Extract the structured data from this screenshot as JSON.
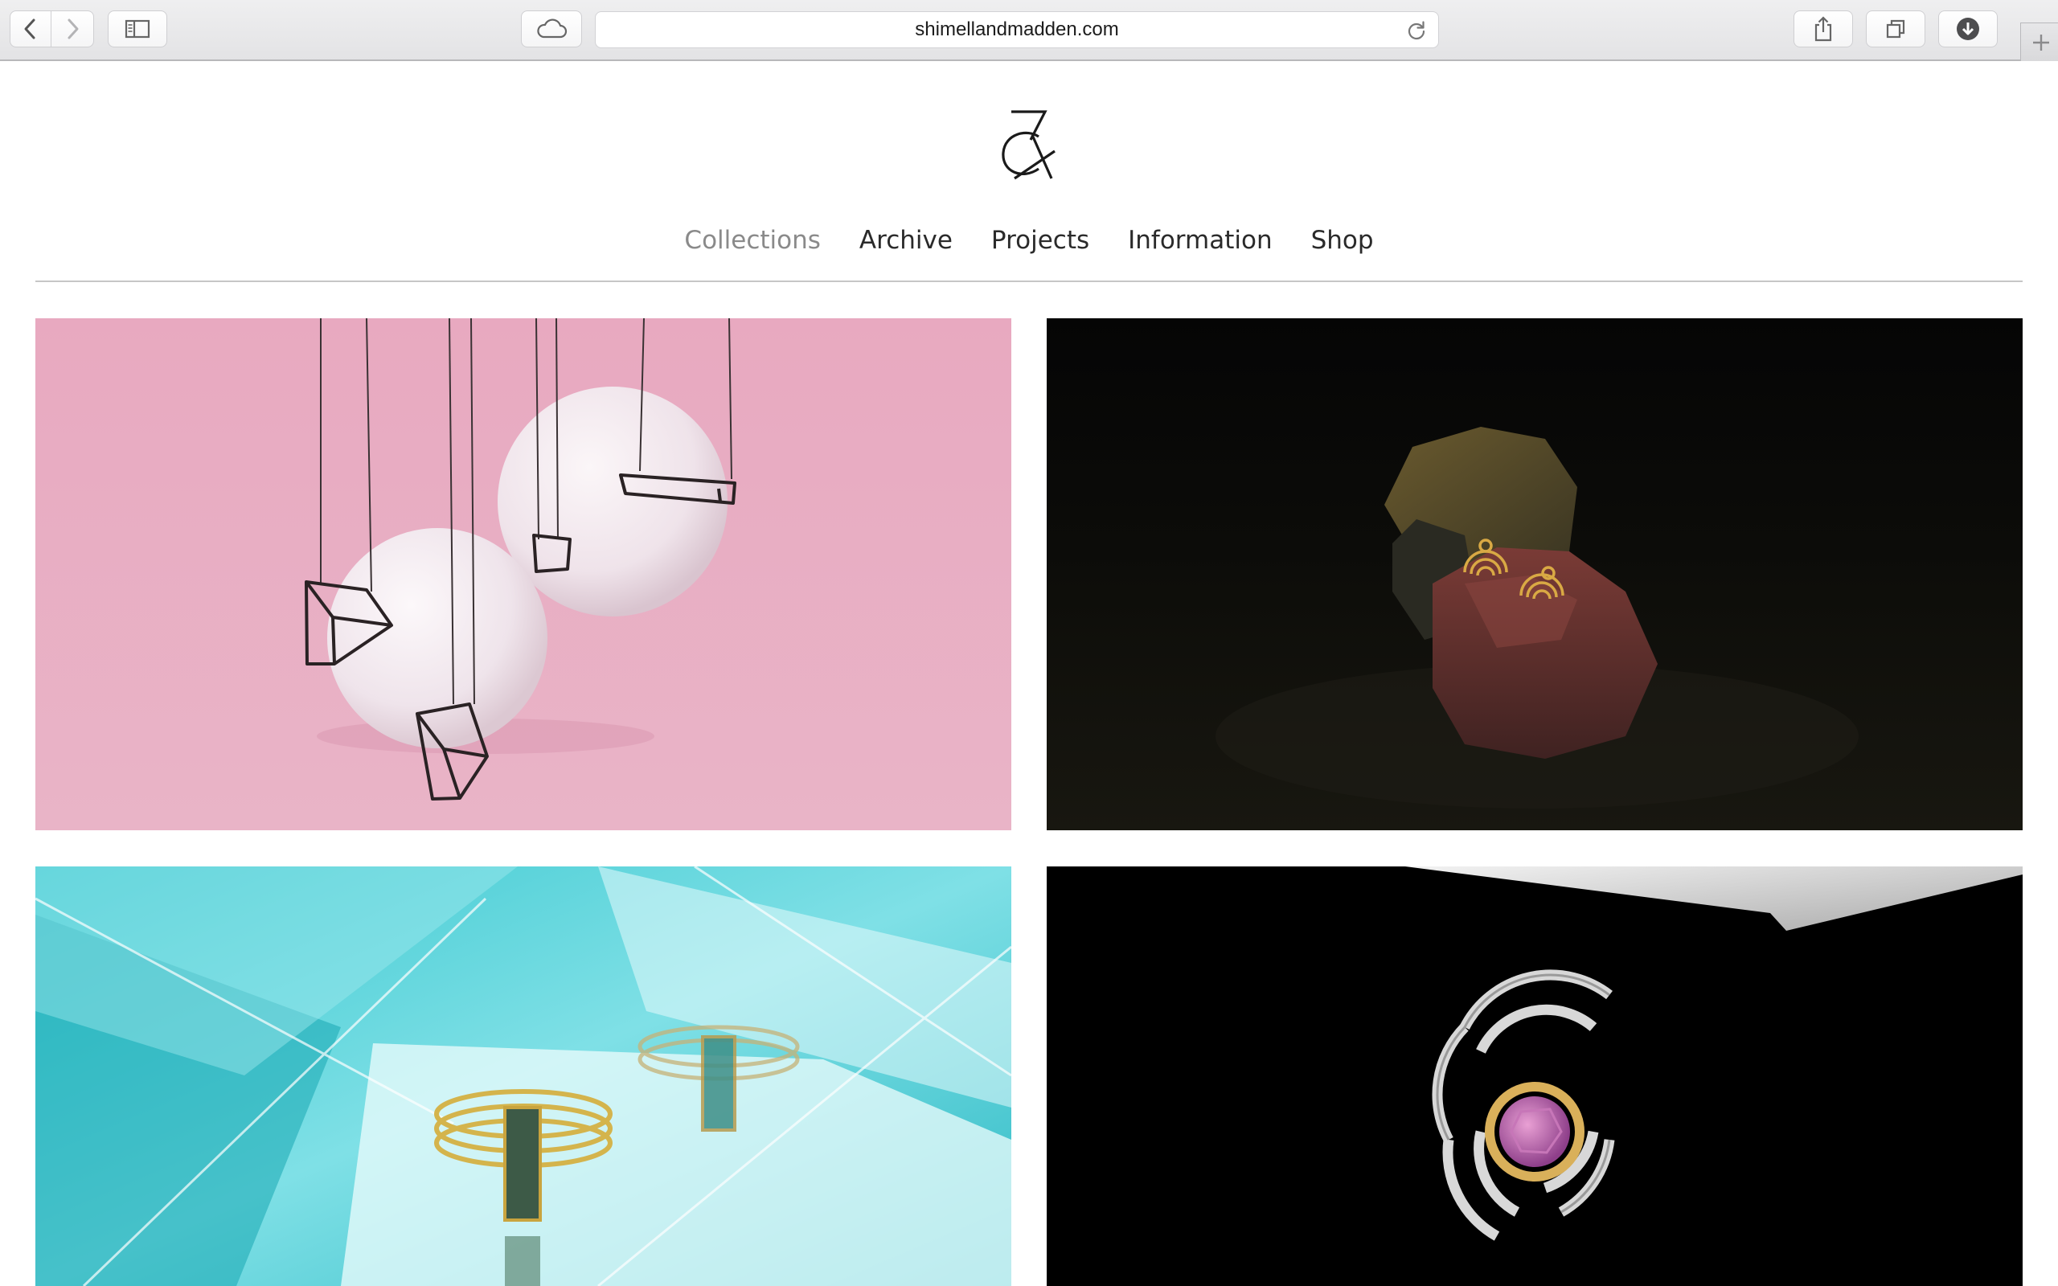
{
  "browser": {
    "url": "shimellandmadden.com",
    "buttons": {
      "back": "back-icon",
      "forward": "forward-icon",
      "sidebar": "sidebar-icon",
      "icloud": "cloud-icon",
      "reload": "reload-icon",
      "share": "share-icon",
      "tabs": "tabs-icon",
      "downloads": "download-icon",
      "new_tab": "plus-icon"
    }
  },
  "site": {
    "logo": "ampersand-logo",
    "nav": [
      {
        "label": "Collections",
        "active": true
      },
      {
        "label": "Archive",
        "active": false
      },
      {
        "label": "Projects",
        "active": false
      },
      {
        "label": "Information",
        "active": false
      },
      {
        "label": "Shop",
        "active": false
      }
    ]
  },
  "tiles": [
    {
      "image": "pink-spheres-geometric-pendants"
    },
    {
      "image": "gold-earrings-on-rocks"
    },
    {
      "image": "gold-rings-on-turquoise-acrylic"
    },
    {
      "image": "silver-brooch-with-pink-stone"
    }
  ],
  "colors": {
    "nav_text": "#2a2a2a",
    "nav_active": "#8a8a8a",
    "divider": "#c6c6c6"
  }
}
